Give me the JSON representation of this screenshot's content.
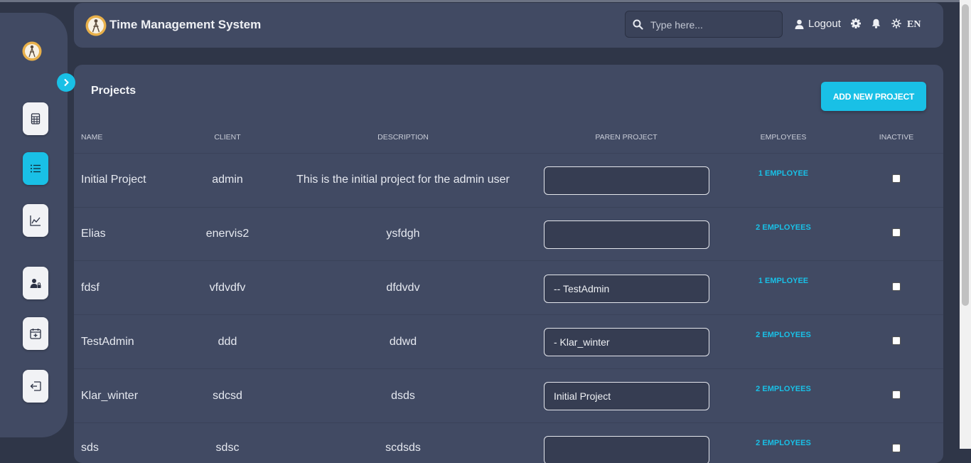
{
  "app": {
    "title": "Time Management System",
    "search_placeholder": "Type here...",
    "logout_label": "Logout",
    "language": "EN"
  },
  "sidebar": {
    "items": [
      {
        "icon": "spreadsheet-icon",
        "active": false
      },
      {
        "icon": "list-icon",
        "active": true
      },
      {
        "icon": "chart-line-icon",
        "active": false
      },
      {
        "icon": "user-lock-icon",
        "active": false
      },
      {
        "icon": "calendar-plus-icon",
        "active": false
      },
      {
        "icon": "sign-out-icon",
        "active": false
      }
    ]
  },
  "page": {
    "title": "Projects",
    "add_button_label": "ADD NEW PROJECT"
  },
  "table": {
    "columns": [
      "NAME",
      "CLIENT",
      "DESCRIPTION",
      "PAREN PROJECT",
      "EMPLOYEES",
      "INACTIVE"
    ],
    "rows": [
      {
        "name": "Initial Project",
        "client": "admin",
        "description": "This is the initial project for the admin user",
        "parent": "",
        "employees": "1 EMPLOYEE",
        "inactive": false
      },
      {
        "name": "Elias",
        "client": "enervis2",
        "description": "ysfdgh",
        "parent": "",
        "employees": "2 EMPLOYEES",
        "inactive": false
      },
      {
        "name": "fdsf",
        "client": "vfdvdfv",
        "description": "dfdvdv",
        "parent": "-- TestAdmin",
        "employees": "1 EMPLOYEE",
        "inactive": false
      },
      {
        "name": "TestAdmin",
        "client": "ddd",
        "description": "ddwd",
        "parent": "- Klar_winter",
        "employees": "2 EMPLOYEES",
        "inactive": false
      },
      {
        "name": "Klar_winter",
        "client": "sdcsd",
        "description": "dsds",
        "parent": "Initial Project",
        "employees": "2 EMPLOYEES",
        "inactive": false
      },
      {
        "name": "sds",
        "client": "sdsc",
        "description": "scdsds",
        "parent": "",
        "employees": "2 EMPLOYEES",
        "inactive": false
      }
    ]
  },
  "colors": {
    "accent": "#19c0e6",
    "panel": "#414a63",
    "background": "#2f3648"
  }
}
